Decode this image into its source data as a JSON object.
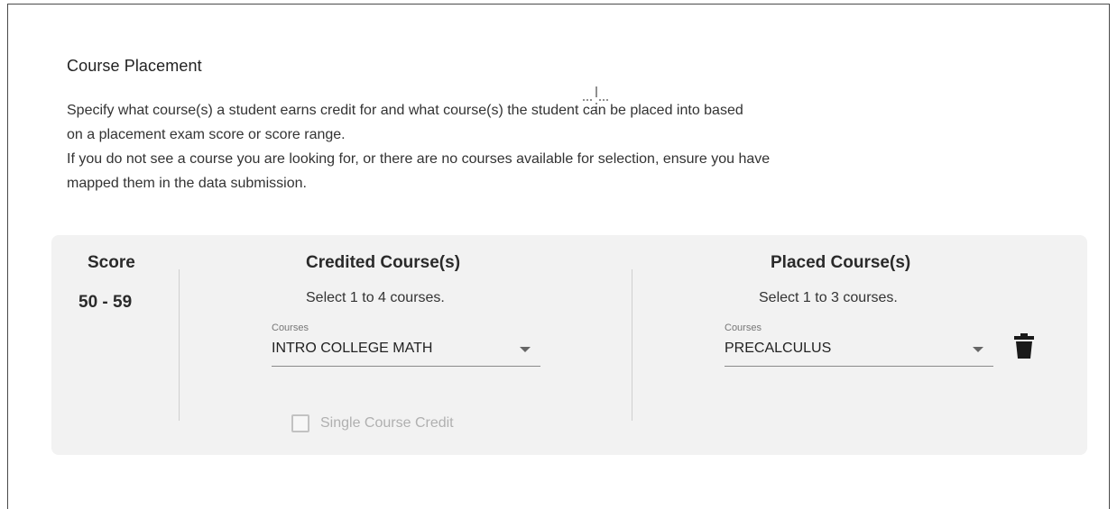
{
  "section": {
    "title": "Course Placement",
    "description_lines": [
      "Specify what course(s) a student earns credit for and what course(s) the student can be placed into based",
      "on a placement exam score or score range.",
      "If you do not see a course you are looking for, or there are no courses available for selection, ensure you have",
      "mapped them in the data submission."
    ]
  },
  "row": {
    "score_header": "Score",
    "score_value": "50 - 59",
    "credited": {
      "header": "Credited Course(s)",
      "hint": "Select 1 to 4 courses.",
      "field_label": "Courses",
      "value": "INTRO COLLEGE MATH"
    },
    "placed": {
      "header": "Placed Course(s)",
      "hint": "Select 1 to 3 courses.",
      "field_label": "Courses",
      "value": "PRECALCULUS"
    },
    "single_credit_label": "Single Course Credit",
    "single_credit_checked": false,
    "delete_icon": "trash-icon"
  }
}
